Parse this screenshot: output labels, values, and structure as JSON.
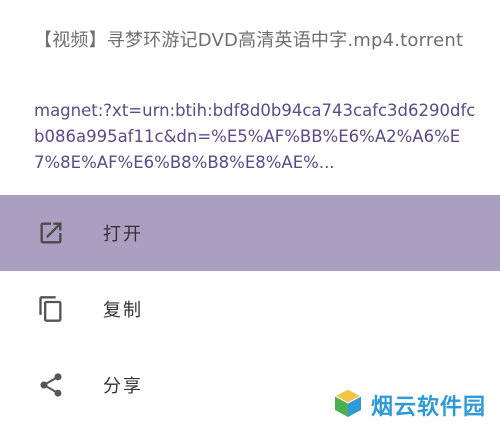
{
  "dialog": {
    "file_name": "【视频】寻梦环游记DVD高清英语中字.mp4.torrent",
    "magnet_link": "magnet:?xt=urn:btih:bdf8d0b94ca743cafc3d6290dfcb086a995af11c&dn=%E5%AF%BB%E6%A2%A6%E7%8E%AF%E6%B8%B8%E8%AE%..."
  },
  "actions": [
    {
      "label": "打开",
      "icon": "open-in-new-icon",
      "selected": true
    },
    {
      "label": "复制",
      "icon": "copy-icon",
      "selected": false
    },
    {
      "label": "分享",
      "icon": "share-icon",
      "selected": false
    }
  ],
  "watermark": {
    "text": "烟云软件园",
    "logo": "cube-logo"
  },
  "colors": {
    "selected_row": "#a99fc1",
    "link_text": "#5b4b8a",
    "icon": "#555555",
    "watermark": "#2f9ad8"
  }
}
